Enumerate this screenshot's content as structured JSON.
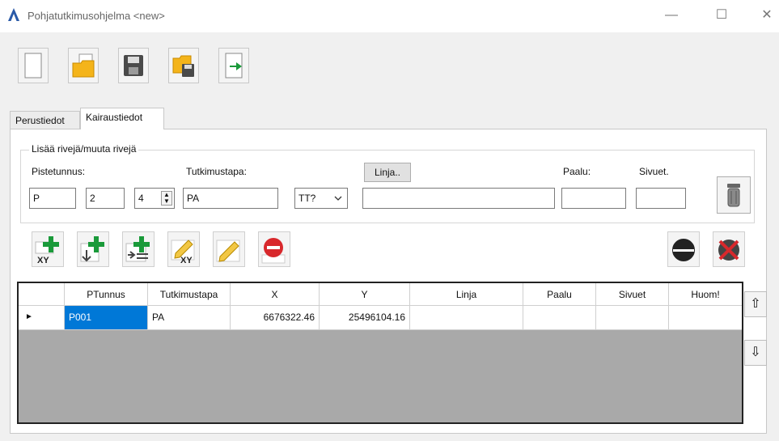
{
  "window": {
    "title": "Pohjatutkimusohjelma <new>",
    "minimize_glyph": "—",
    "maximize_glyph": "☐",
    "close_glyph": "✕"
  },
  "toolbar": {
    "icons": [
      "new-file-icon",
      "open-folder-icon",
      "save-icon",
      "save-as-icon",
      "exit-icon"
    ]
  },
  "tabs": [
    {
      "label": "Perustiedot",
      "active": false
    },
    {
      "label": "Kairaustiedot",
      "active": true
    }
  ],
  "group": {
    "title": "Lisää rivejä/muuta rivejä",
    "pistetunnus_label": "Pistetunnus:",
    "tutkimustapa_label": "Tutkimustapa:",
    "linja_button": "Linja..",
    "paalu_label": "Paalu:",
    "sivuet_label": "Sivuet.",
    "prefix_value": "P",
    "number_value": "2",
    "digits_value": "4",
    "tutkimustapa_value": "PA",
    "combo_value": "TT?",
    "linja_value": "",
    "paalu_value": "",
    "sivuet_value": ""
  },
  "actions": {
    "icons": [
      "add-xy-icon",
      "add-below-icon",
      "insert-row-icon",
      "edit-xy-icon",
      "edit-icon",
      "delete-icon",
      "half-circle-icon",
      "delete-x-icon"
    ]
  },
  "table": {
    "columns": [
      "PTunnus",
      "Tutkimustapa",
      "X",
      "Y",
      "Linja",
      "Paalu",
      "Sivuet",
      "Huom!"
    ],
    "rows": [
      {
        "indicator": "►",
        "PTunnus": "P001",
        "Tutkimustapa": "PA",
        "X": "6676322.46",
        "Y": "25496104.16",
        "Linja": "",
        "Paalu": "",
        "Sivuet": "",
        "Huom": ""
      }
    ]
  },
  "side": {
    "up_glyph": "⇧",
    "down_glyph": "⇩"
  },
  "colors": {
    "selection": "#0078d7",
    "grid_empty": "#a9a9a9",
    "add_green": "#1a9a3a",
    "delete_red": "#d8282c"
  }
}
